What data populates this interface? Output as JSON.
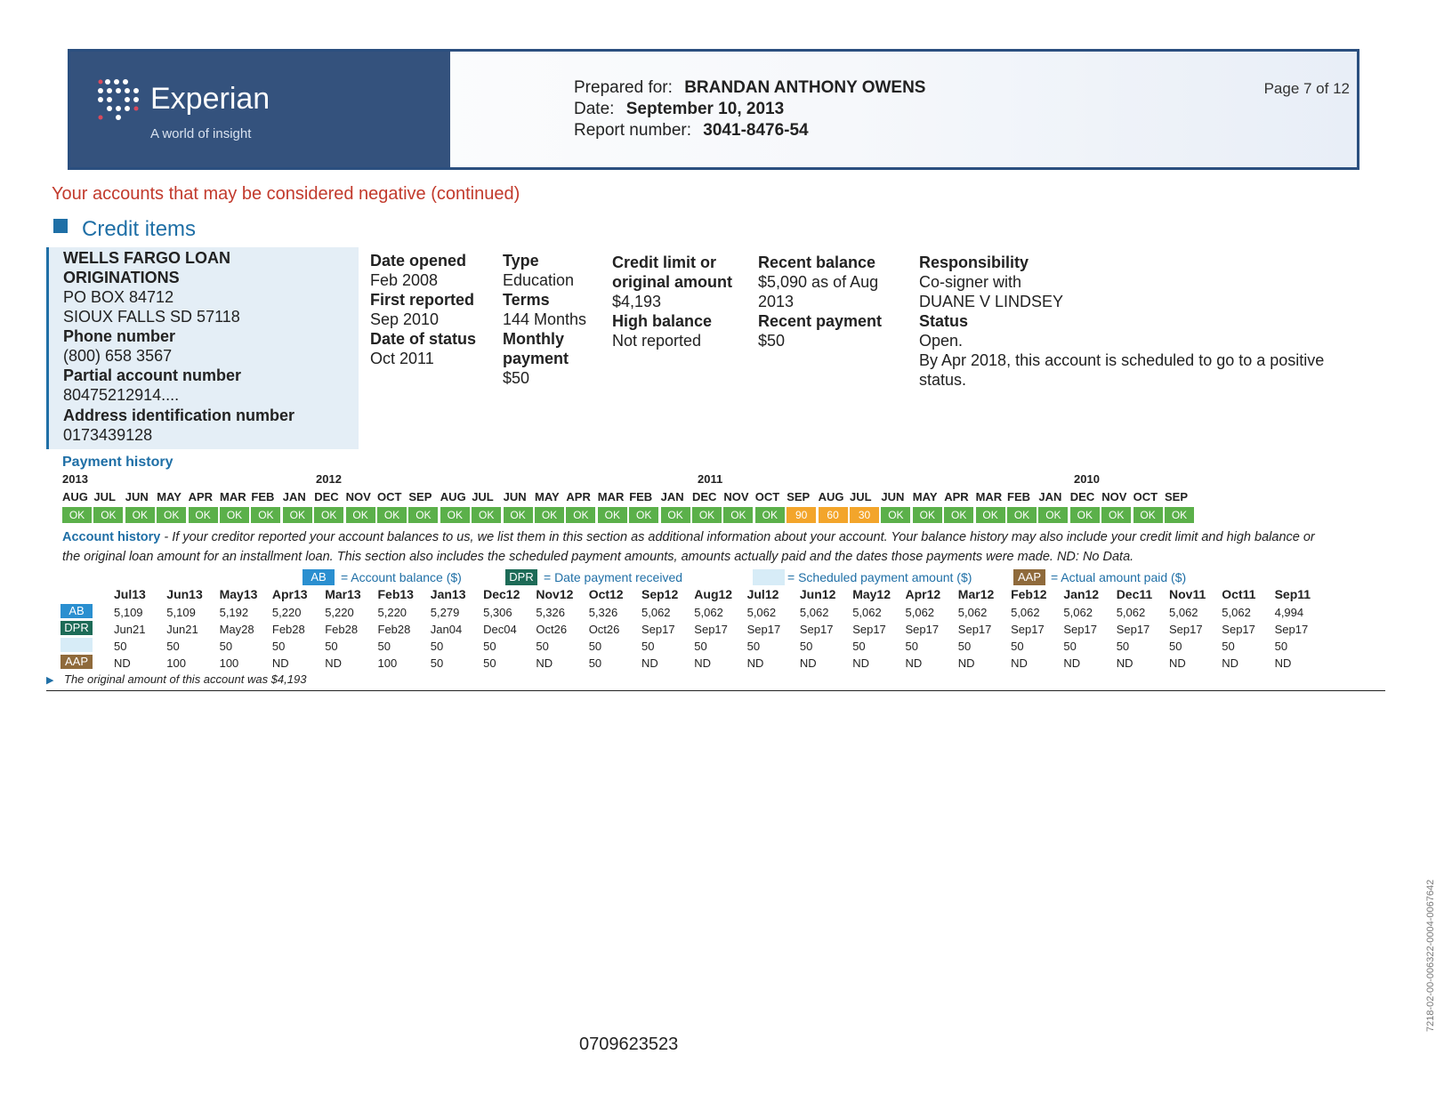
{
  "header": {
    "brand": "Experian",
    "tagline": "A world of insight",
    "prepared_for_label": "Prepared for:",
    "prepared_for": "BRANDAN ANTHONY OWENS",
    "date_label": "Date:",
    "date": "September 10, 2013",
    "report_label": "Report number:",
    "report_number": "3041-8476-54",
    "page": "Page 7 of 12"
  },
  "negative_title": "Your accounts that may be considered negative (continued)",
  "credit_items_title": "Credit items",
  "account": {
    "name_line1": "WELLS FARGO LOAN",
    "name_line2": "ORIGINATIONS",
    "address1": "PO BOX 84712",
    "address2": "SIOUX FALLS SD 57118",
    "phone_label": "Phone number",
    "phone": "(800) 658 3567",
    "partial_acct_label": "Partial account number",
    "partial_acct": "80475212914....",
    "addr_id_label": "Address identification number",
    "addr_id": "0173439128"
  },
  "details": {
    "date_opened_label": "Date opened",
    "date_opened": "Feb 2008",
    "first_reported_label": "First reported",
    "first_reported": "Sep 2010",
    "date_status_label": "Date of status",
    "date_status": "Oct 2011",
    "type_label": "Type",
    "type": "Education",
    "terms_label": "Terms",
    "terms": "144 Months",
    "monthly_label1": "Monthly",
    "monthly_label2": "payment",
    "monthly": "$50",
    "credit_limit_label1": "Credit limit or",
    "credit_limit_label2": "original amount",
    "credit_limit": "$4,193",
    "high_balance_label": "High balance",
    "high_balance": "Not reported",
    "recent_balance_label": "Recent balance",
    "recent_balance1": "$5,090 as of Aug",
    "recent_balance2": "2013",
    "recent_payment_label": "Recent payment",
    "recent_payment": "$50",
    "responsibility_label": "Responsibility",
    "responsibility1": "Co-signer with",
    "responsibility2": "DUANE V LINDSEY",
    "status_label": "Status",
    "status1": "Open.",
    "status2": "By Apr 2018, this account is scheduled to go to a positive",
    "status3": "status."
  },
  "payment_history": {
    "title": "Payment history",
    "years": [
      "2013",
      "2012",
      "2011",
      "2010"
    ],
    "months": [
      "AUG",
      "JUL",
      "JUN",
      "MAY",
      "APR",
      "MAR",
      "FEB",
      "JAN",
      "DEC",
      "NOV",
      "OCT",
      "SEP",
      "AUG",
      "JUL",
      "JUN",
      "MAY",
      "APR",
      "MAR",
      "FEB",
      "JAN",
      "DEC",
      "NOV",
      "OCT",
      "SEP",
      "AUG",
      "JUL",
      "JUN",
      "MAY",
      "APR",
      "MAR",
      "FEB",
      "JAN",
      "DEC",
      "NOV",
      "OCT",
      "SEP"
    ],
    "statuses": [
      "OK",
      "OK",
      "OK",
      "OK",
      "OK",
      "OK",
      "OK",
      "OK",
      "OK",
      "OK",
      "OK",
      "OK",
      "OK",
      "OK",
      "OK",
      "OK",
      "OK",
      "OK",
      "OK",
      "OK",
      "OK",
      "OK",
      "OK",
      "90",
      "60",
      "30",
      "OK",
      "OK",
      "OK",
      "OK",
      "OK",
      "OK",
      "OK",
      "OK",
      "OK",
      "OK"
    ],
    "colors": {
      "ok": "#5bb04a",
      "late": "#f3a52b"
    }
  },
  "account_history": {
    "title": "Account history",
    "text1": " - If your creditor reported your account balances to us, we list them in this section as additional information about your account. Your balance history may also include your credit limit and high balance or",
    "text2": "the original loan amount for an installment loan. This section also includes the scheduled payment amounts, amounts actually paid and the dates those payments were made.  ND: No Data.",
    "legend": {
      "ab_tag": "AB",
      "ab_text": "= Account balance ($)",
      "dpr_tag": "DPR",
      "dpr_text": "= Date payment received",
      "sch_tag": "",
      "sch_text": "= Scheduled payment amount ($)",
      "aap_tag": "AAP",
      "aap_text": "= Actual amount paid ($)"
    },
    "columns": [
      "Jul13",
      "Jun13",
      "May13",
      "Apr13",
      "Mar13",
      "Feb13",
      "Jan13",
      "Dec12",
      "Nov12",
      "Oct12",
      "Sep12",
      "Aug12",
      "Jul12",
      "Jun12",
      "May12",
      "Apr12",
      "Mar12",
      "Feb12",
      "Jan12",
      "Dec11",
      "Nov11",
      "Oct11",
      "Sep11"
    ],
    "ab": [
      "5,109",
      "5,109",
      "5,192",
      "5,220",
      "5,220",
      "5,220",
      "5,279",
      "5,306",
      "5,326",
      "5,326",
      "5,062",
      "5,062",
      "5,062",
      "5,062",
      "5,062",
      "5,062",
      "5,062",
      "5,062",
      "5,062",
      "5,062",
      "5,062",
      "5,062",
      "4,994"
    ],
    "dpr": [
      "Jun21",
      "Jun21",
      "May28",
      "Feb28",
      "Feb28",
      "Feb28",
      "Jan04",
      "Dec04",
      "Oct26",
      "Oct26",
      "Sep17",
      "Sep17",
      "Sep17",
      "Sep17",
      "Sep17",
      "Sep17",
      "Sep17",
      "Sep17",
      "Sep17",
      "Sep17",
      "Sep17",
      "Sep17",
      "Sep17"
    ],
    "sch": [
      "50",
      "50",
      "50",
      "50",
      "50",
      "50",
      "50",
      "50",
      "50",
      "50",
      "50",
      "50",
      "50",
      "50",
      "50",
      "50",
      "50",
      "50",
      "50",
      "50",
      "50",
      "50",
      "50"
    ],
    "aap": [
      "ND",
      "100",
      "100",
      "ND",
      "ND",
      "100",
      "50",
      "50",
      "ND",
      "50",
      "ND",
      "ND",
      "ND",
      "ND",
      "ND",
      "ND",
      "ND",
      "ND",
      "ND",
      "ND",
      "ND",
      "ND",
      "ND"
    ],
    "colors": {
      "ab": "#2a8fd0",
      "dpr": "#1d6b57",
      "sch": "#d7ecf7",
      "aap": "#8f6a3b",
      "text_blue": "#1f6fa6"
    }
  },
  "original_note": "The original amount of this account was $4,193",
  "footer_number": "0709623523",
  "side_code": "7218-02-00-006322-0004-0067642"
}
